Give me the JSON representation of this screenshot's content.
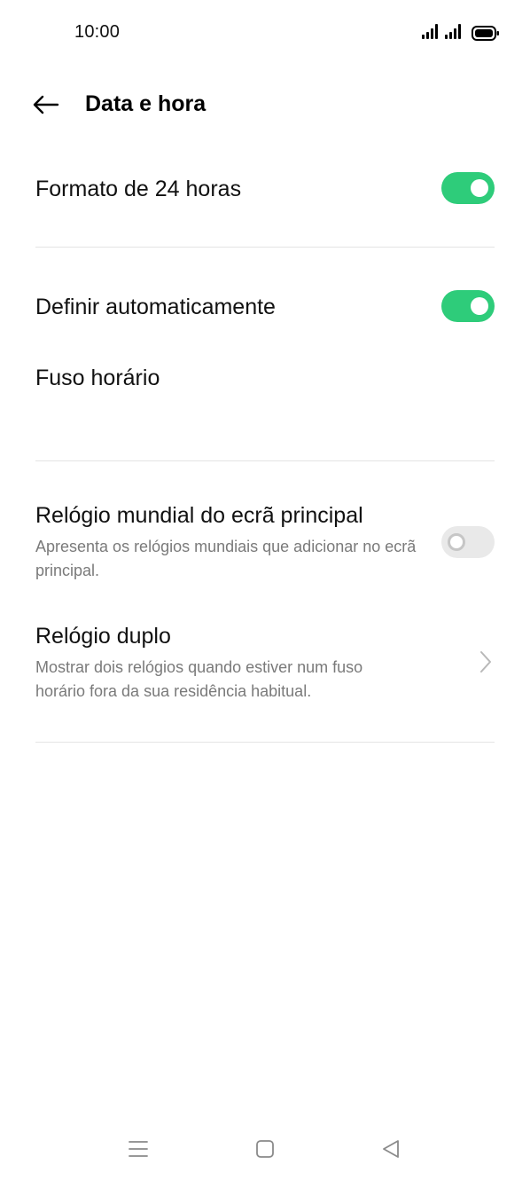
{
  "status_bar": {
    "time": "10:00",
    "icons": [
      "signal-icon",
      "signal-icon",
      "battery-icon"
    ]
  },
  "header": {
    "back_icon": "back-arrow-icon",
    "title": "Data e hora"
  },
  "settings": {
    "format24": {
      "label": "Formato de 24 horas",
      "enabled": true
    },
    "auto_set": {
      "label": "Definir automaticamente",
      "enabled": true
    },
    "timezone": {
      "label": "Fuso horário"
    },
    "world_clock": {
      "label": "Relógio mundial do ecrã principal",
      "description": "Apresenta os relógios mundiais que adicionar no ecrã principal.",
      "enabled": false
    },
    "dual_clock": {
      "label": "Relógio duplo",
      "description": "Mostrar dois relógios quando estiver num fuso horário fora da sua residência habitual.",
      "icon": "chevron-right-icon"
    }
  },
  "colors": {
    "toggle_on": "#2ecc7a",
    "toggle_off": "#e9e9e9",
    "subtitle": "#7a7a7a",
    "divider": "#e4e4e4"
  },
  "nav_bar": {
    "icons": [
      "menu-icon",
      "home-icon",
      "back-icon"
    ]
  }
}
